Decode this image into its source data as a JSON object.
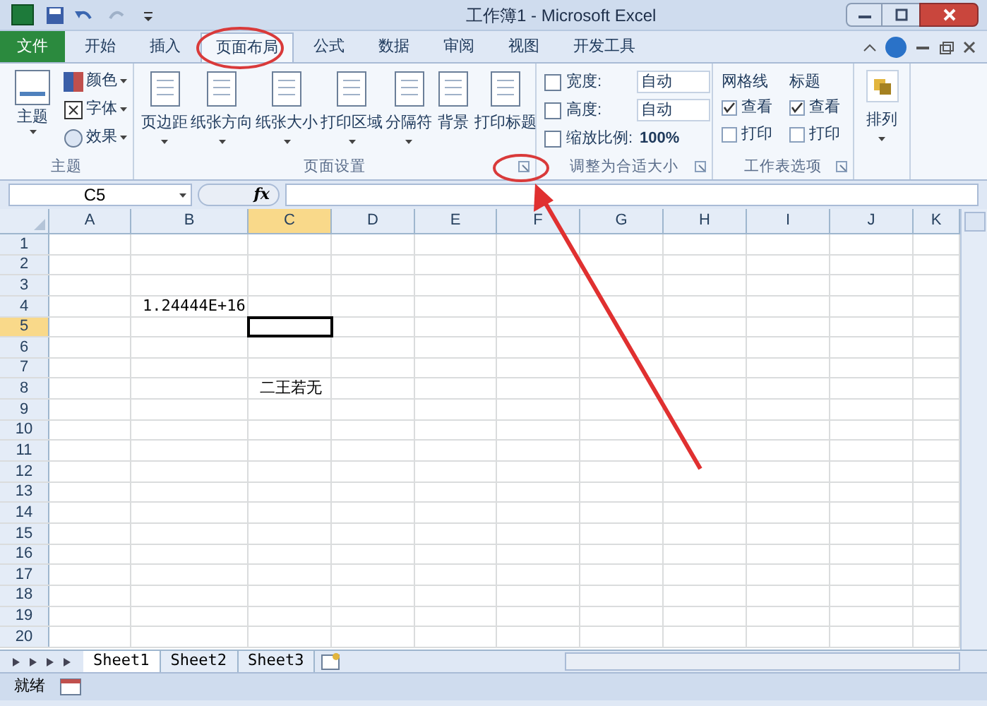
{
  "window": {
    "title": "工作簿1 - Microsoft Excel"
  },
  "tabs": [
    {
      "label": "文件",
      "kind": "file",
      "selected": false
    },
    {
      "label": "开始",
      "kind": "tab",
      "selected": false
    },
    {
      "label": "插入",
      "kind": "tab",
      "selected": false
    },
    {
      "label": "页面布局",
      "kind": "tab",
      "selected": true
    },
    {
      "label": "公式",
      "kind": "tab",
      "selected": false
    },
    {
      "label": "数据",
      "kind": "tab",
      "selected": false
    },
    {
      "label": "审阅",
      "kind": "tab",
      "selected": false
    },
    {
      "label": "视图",
      "kind": "tab",
      "selected": false
    },
    {
      "label": "开发工具",
      "kind": "tab",
      "selected": false
    }
  ],
  "ribbon": {
    "themes": {
      "label": "主题",
      "big": "主题",
      "items": [
        "颜色",
        "字体",
        "效果"
      ]
    },
    "page_setup": {
      "label": "页面设置",
      "buttons": [
        "页边距",
        "纸张方向",
        "纸张大小",
        "打印区域",
        "分隔符",
        "背景",
        "打印标题"
      ]
    },
    "scale": {
      "label": "调整为合适大小",
      "rows": [
        {
          "label": "宽度:",
          "value": "自动"
        },
        {
          "label": "高度:",
          "value": "自动"
        },
        {
          "label": "缩放比例:",
          "value": "100%"
        }
      ]
    },
    "sheet_options": {
      "label": "工作表选项",
      "columns": [
        {
          "title": "网格线",
          "view": {
            "label": "查看",
            "checked": true
          },
          "print": {
            "label": "打印",
            "checked": false
          }
        },
        {
          "title": "标题",
          "view": {
            "label": "查看",
            "checked": true
          },
          "print": {
            "label": "打印",
            "checked": false
          }
        }
      ]
    },
    "arrange": {
      "button": "排列"
    }
  },
  "formula_bar": {
    "name_box": "C5",
    "fx": "fx"
  },
  "grid": {
    "columns": [
      {
        "label": "A",
        "selected": false
      },
      {
        "label": "B",
        "selected": false
      },
      {
        "label": "C",
        "selected": true
      },
      {
        "label": "D",
        "selected": false
      },
      {
        "label": "E",
        "selected": false
      },
      {
        "label": "F",
        "selected": false
      },
      {
        "label": "G",
        "selected": false
      },
      {
        "label": "H",
        "selected": false
      },
      {
        "label": "I",
        "selected": false
      },
      {
        "label": "J",
        "selected": false
      },
      {
        "label": "K",
        "selected": false
      }
    ],
    "rows": [
      {
        "label": "1",
        "selected": false
      },
      {
        "label": "2",
        "selected": false
      },
      {
        "label": "3",
        "selected": false
      },
      {
        "label": "4",
        "selected": false,
        "cells": [
          {
            "active": false
          },
          {
            "text": "1.24444E+16",
            "active": false
          }
        ]
      },
      {
        "label": "5",
        "selected": true,
        "cells": [
          {
            "active": false
          },
          {
            "active": false
          },
          {
            "active": true
          }
        ]
      },
      {
        "label": "6",
        "selected": false
      },
      {
        "label": "7",
        "selected": false
      },
      {
        "label": "8",
        "selected": false,
        "cells": [
          {
            "active": false
          },
          {
            "active": false
          },
          {
            "text": "二王若无",
            "active": false
          }
        ]
      },
      {
        "label": "9",
        "selected": false
      },
      {
        "label": "10",
        "selected": false
      },
      {
        "label": "11",
        "selected": false
      },
      {
        "label": "12",
        "selected": false
      },
      {
        "label": "13",
        "selected": false
      },
      {
        "label": "14",
        "selected": false
      },
      {
        "label": "15",
        "selected": false
      },
      {
        "label": "16",
        "selected": false
      },
      {
        "label": "17",
        "selected": false
      },
      {
        "label": "18",
        "selected": false
      },
      {
        "label": "19",
        "selected": false
      },
      {
        "label": "20",
        "selected": false
      }
    ]
  },
  "sheet_tabs": [
    {
      "label": "Sheet1",
      "selected": true
    },
    {
      "label": "Sheet2",
      "selected": false
    },
    {
      "label": "Sheet3",
      "selected": false
    }
  ],
  "status_bar": {
    "text": "就绪"
  }
}
